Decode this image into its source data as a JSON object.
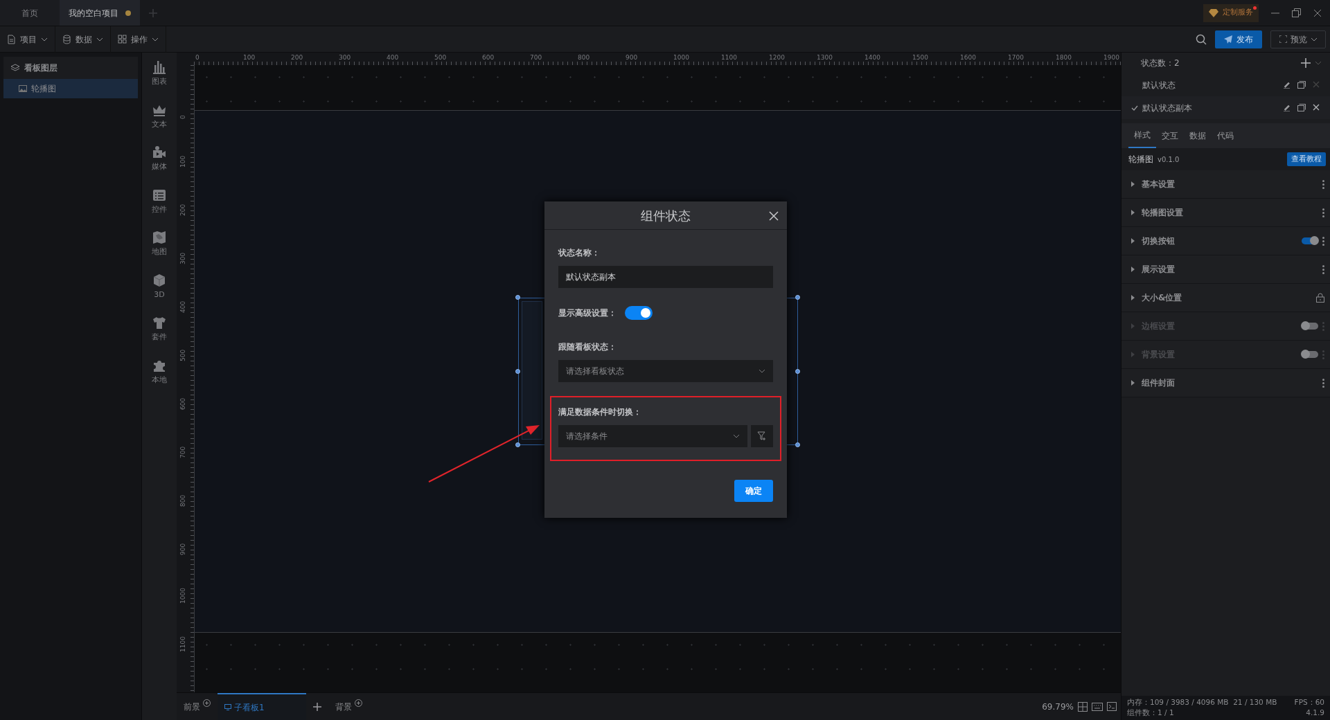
{
  "tabs": [
    {
      "label": "首页",
      "selected": false,
      "modified": false
    },
    {
      "label": "我的空白项目",
      "selected": true,
      "modified": true
    }
  ],
  "custom_service": {
    "label": "定制服务",
    "notification": true
  },
  "toolbar": {
    "menus": [
      "项目",
      "数据",
      "操作"
    ],
    "publish_button": "发布",
    "preview_button": "预览"
  },
  "layers": {
    "title": "看板图层",
    "items": [
      {
        "label": "轮播图",
        "selected": true
      }
    ]
  },
  "component_library": [
    "图表",
    "文本",
    "媒体",
    "控件",
    "地图",
    "3D",
    "套件",
    "本地"
  ],
  "ruler": {
    "x_labels": [
      "0",
      "100",
      "200",
      "300",
      "400",
      "500",
      "600",
      "700",
      "800",
      "900",
      "1000",
      "1100",
      "1200",
      "1300",
      "1400",
      "1500",
      "1600",
      "1700",
      "1800",
      "1900"
    ],
    "y_labels": [
      "0",
      "100",
      "200",
      "300",
      "400",
      "500",
      "600",
      "700",
      "800",
      "900",
      "1000",
      "1100"
    ]
  },
  "dialog": {
    "title": "组件状态",
    "fields": [
      {
        "kind": "text",
        "label": "状态名称：",
        "value": "默认状态副本"
      },
      {
        "kind": "switch",
        "label": "显示高级设置：",
        "on": true
      },
      {
        "kind": "select",
        "label": "跟随看板状态：",
        "placeholder": "请选择看板状态"
      },
      {
        "kind": "condition",
        "label": "满足数据条件时切换：",
        "placeholder": "请选择条件",
        "highlighted": true
      }
    ],
    "confirm_button": "确定"
  },
  "right_panel": {
    "state_count": "状态数：2",
    "states": [
      {
        "label": "默认状态",
        "selected": false,
        "deletable": false
      },
      {
        "label": "默认状态副本",
        "selected": true,
        "deletable": true
      }
    ],
    "tabs": [
      {
        "label": "样式",
        "selected": true
      },
      {
        "label": "交互",
        "selected": false
      },
      {
        "label": "数据",
        "selected": false
      },
      {
        "label": "代码",
        "selected": false
      }
    ],
    "component_name": "轮播图",
    "version": "v0.1.0",
    "tutorial_button": "查看教程",
    "sections": [
      {
        "label": "基本设置",
        "kind": "menu",
        "disabled": false
      },
      {
        "label": "轮播图设置",
        "kind": "menu",
        "disabled": false
      },
      {
        "label": "切换按钮",
        "kind": "toggle",
        "on": true,
        "disabled": false
      },
      {
        "label": "展示设置",
        "kind": "menu",
        "disabled": false
      },
      {
        "label": "大小&位置",
        "kind": "lock",
        "disabled": false
      },
      {
        "label": "边框设置",
        "kind": "toggle",
        "on": false,
        "disabled": true
      },
      {
        "label": "背景设置",
        "kind": "toggle",
        "on": false,
        "disabled": true
      },
      {
        "label": "组件封面",
        "kind": "menu",
        "disabled": false
      }
    ]
  },
  "bottom_bar": {
    "boards": [
      {
        "label": "前景",
        "kind": "layer",
        "selected": false
      },
      {
        "label": "子看板1",
        "kind": "board",
        "selected": true
      },
      {
        "kind": "add"
      },
      {
        "label": "背景",
        "kind": "layer",
        "selected": false
      }
    ],
    "zoom": "69.79%"
  },
  "status": {
    "memory": "内存：109 / 3983 / 4096 MB  21 / 130 MB",
    "fps": "FPS：60",
    "components": "组件数：1 / 1",
    "version": "4.1.9"
  }
}
